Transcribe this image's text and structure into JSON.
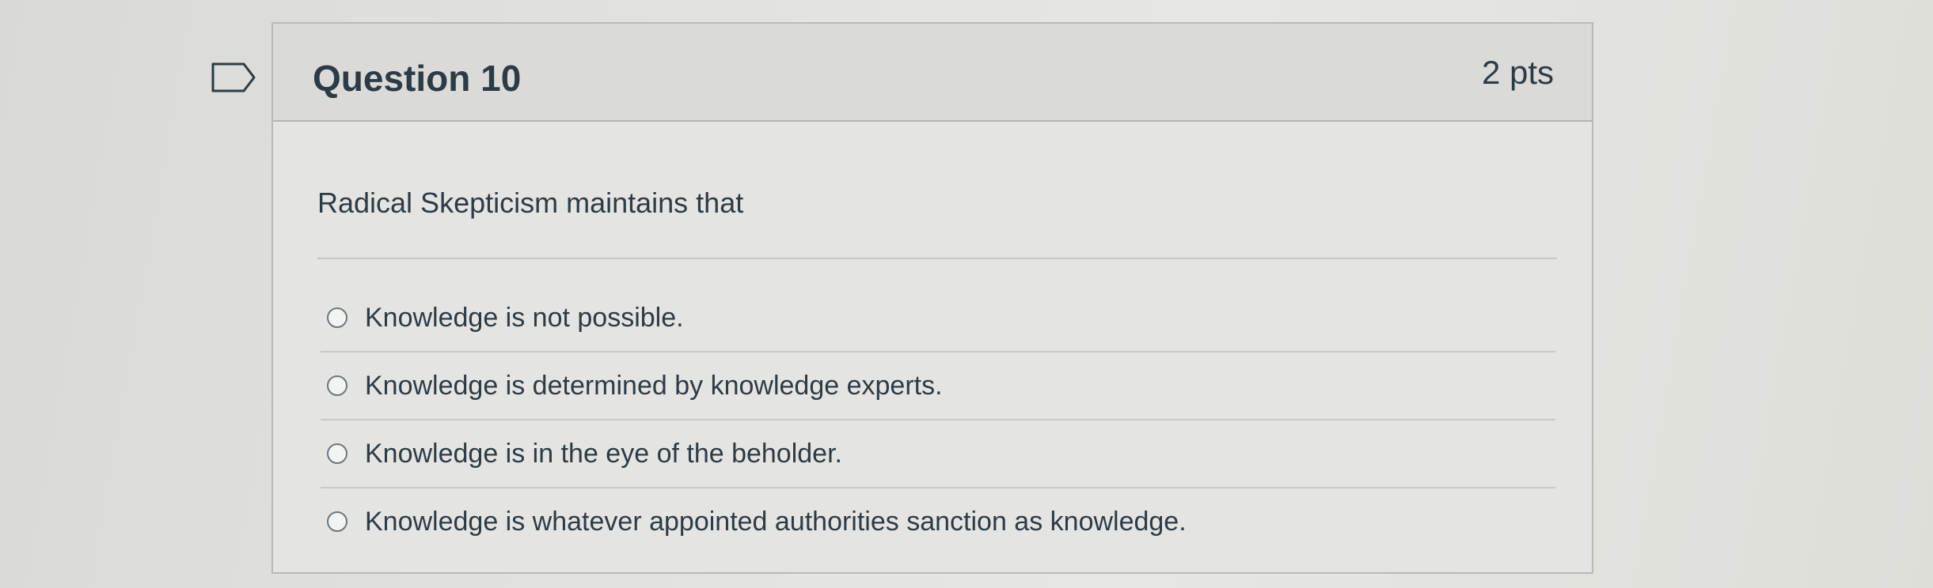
{
  "question": {
    "title": "Question 10",
    "points": "2 pts",
    "prompt": "Radical Skepticism maintains that",
    "flag_icon": "flag-outline-icon",
    "answers": [
      {
        "label": "Knowledge is not possible.",
        "selected": false
      },
      {
        "label": "Knowledge is determined by knowledge experts.",
        "selected": false
      },
      {
        "label": "Knowledge is in the eye of the beholder.",
        "selected": false
      },
      {
        "label": "Knowledge is whatever appointed authorities sanction as knowledge.",
        "selected": false
      }
    ]
  },
  "colors": {
    "text": "#2d3b45",
    "header_bg": "#dadbd8",
    "card_bg": "#e4e5e2",
    "border": "#b9bab6"
  }
}
